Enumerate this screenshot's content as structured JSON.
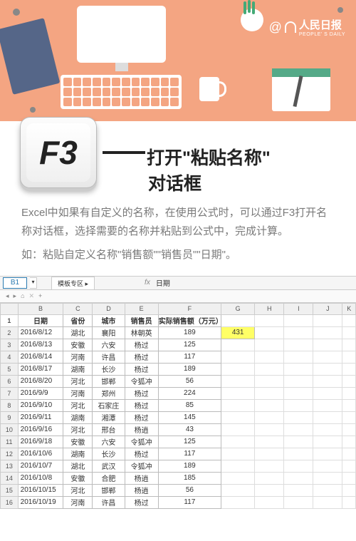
{
  "brand": {
    "at": "@",
    "zh": "人民日报",
    "en": "PEOPLE' S DAILY"
  },
  "key": {
    "label": "F3"
  },
  "title": {
    "line1": "打开\"粘贴名称\"",
    "line2": "对话框"
  },
  "desc": {
    "p1": "Excel中如果有自定义的名称，在使用公式时，可以通过F3打开名称对话框，选择需要的名称并粘贴到公式中，完成计算。",
    "p2": "如：粘贴自定义名称\"销售额\"\"销售员\"\"日期\"。"
  },
  "excel": {
    "namebox": "B1",
    "tab": "模板专区",
    "fx": "fx",
    "fxval": "日期",
    "nav": {
      "home": "⌂",
      "x": "✕",
      "plus": "+"
    },
    "cols": [
      "",
      "B",
      "C",
      "D",
      "E",
      "F",
      "G",
      "H",
      "I",
      "J",
      "K"
    ],
    "head": [
      "日期",
      "省份",
      "城市",
      "销售员",
      "实际销售额（万元）"
    ],
    "g2": "431",
    "rows": [
      [
        "2016/8/12",
        "湖北",
        "襄阳",
        "林朝英",
        "189"
      ],
      [
        "2016/8/13",
        "安徽",
        "六安",
        "杨过",
        "125"
      ],
      [
        "2016/8/14",
        "河南",
        "许昌",
        "杨过",
        "117"
      ],
      [
        "2016/8/17",
        "湖南",
        "长沙",
        "杨过",
        "189"
      ],
      [
        "2016/8/20",
        "河北",
        "邯郸",
        "令狐冲",
        "56"
      ],
      [
        "2016/9/9",
        "河南",
        "郑州",
        "杨过",
        "224"
      ],
      [
        "2016/9/10",
        "河北",
        "石家庄",
        "杨过",
        "85"
      ],
      [
        "2016/9/11",
        "湖南",
        "湘潭",
        "杨过",
        "145"
      ],
      [
        "2016/9/16",
        "河北",
        "邢台",
        "杨逍",
        "43"
      ],
      [
        "2016/9/18",
        "安徽",
        "六安",
        "令狐冲",
        "125"
      ],
      [
        "2016/10/6",
        "湖南",
        "长沙",
        "杨过",
        "117"
      ],
      [
        "2016/10/7",
        "湖北",
        "武汉",
        "令狐冲",
        "189"
      ],
      [
        "2016/10/8",
        "安徽",
        "合肥",
        "杨逍",
        "185"
      ],
      [
        "2016/10/15",
        "河北",
        "邯郸",
        "杨逍",
        "56"
      ],
      [
        "2016/10/19",
        "河南",
        "许昌",
        "杨过",
        "117"
      ]
    ]
  }
}
